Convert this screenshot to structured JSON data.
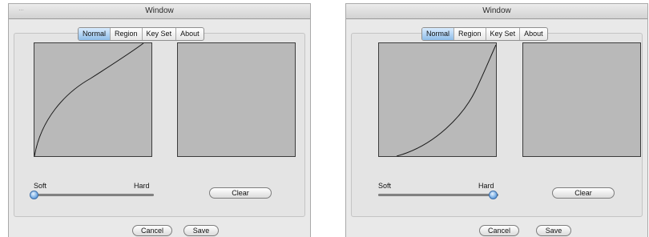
{
  "windows": [
    {
      "title": "Window",
      "background_title": "…",
      "tabs": [
        {
          "label": "Normal",
          "selected": true
        },
        {
          "label": "Region",
          "selected": false
        },
        {
          "label": "Key Set",
          "selected": false
        },
        {
          "label": "About",
          "selected": false
        }
      ],
      "slider": {
        "min_label": "Soft",
        "max_label": "Hard",
        "value": 0.0
      },
      "curve": "concave",
      "clear_label": "Clear",
      "cancel_label": "Cancel",
      "save_label": "Save"
    },
    {
      "title": "Window",
      "tabs": [
        {
          "label": "Normal",
          "selected": true
        },
        {
          "label": "Region",
          "selected": false
        },
        {
          "label": "Key Set",
          "selected": false
        },
        {
          "label": "About",
          "selected": false
        }
      ],
      "slider": {
        "min_label": "Soft",
        "max_label": "Hard",
        "value": 1.0
      },
      "curve": "convex",
      "clear_label": "Clear",
      "cancel_label": "Cancel",
      "save_label": "Save"
    }
  ],
  "colors": {
    "panel_bg": "#e4e4e4",
    "graph_bg": "#b9b9b9",
    "tab_selected": "#8fbde9",
    "slider_knob": "#5b95d6"
  }
}
